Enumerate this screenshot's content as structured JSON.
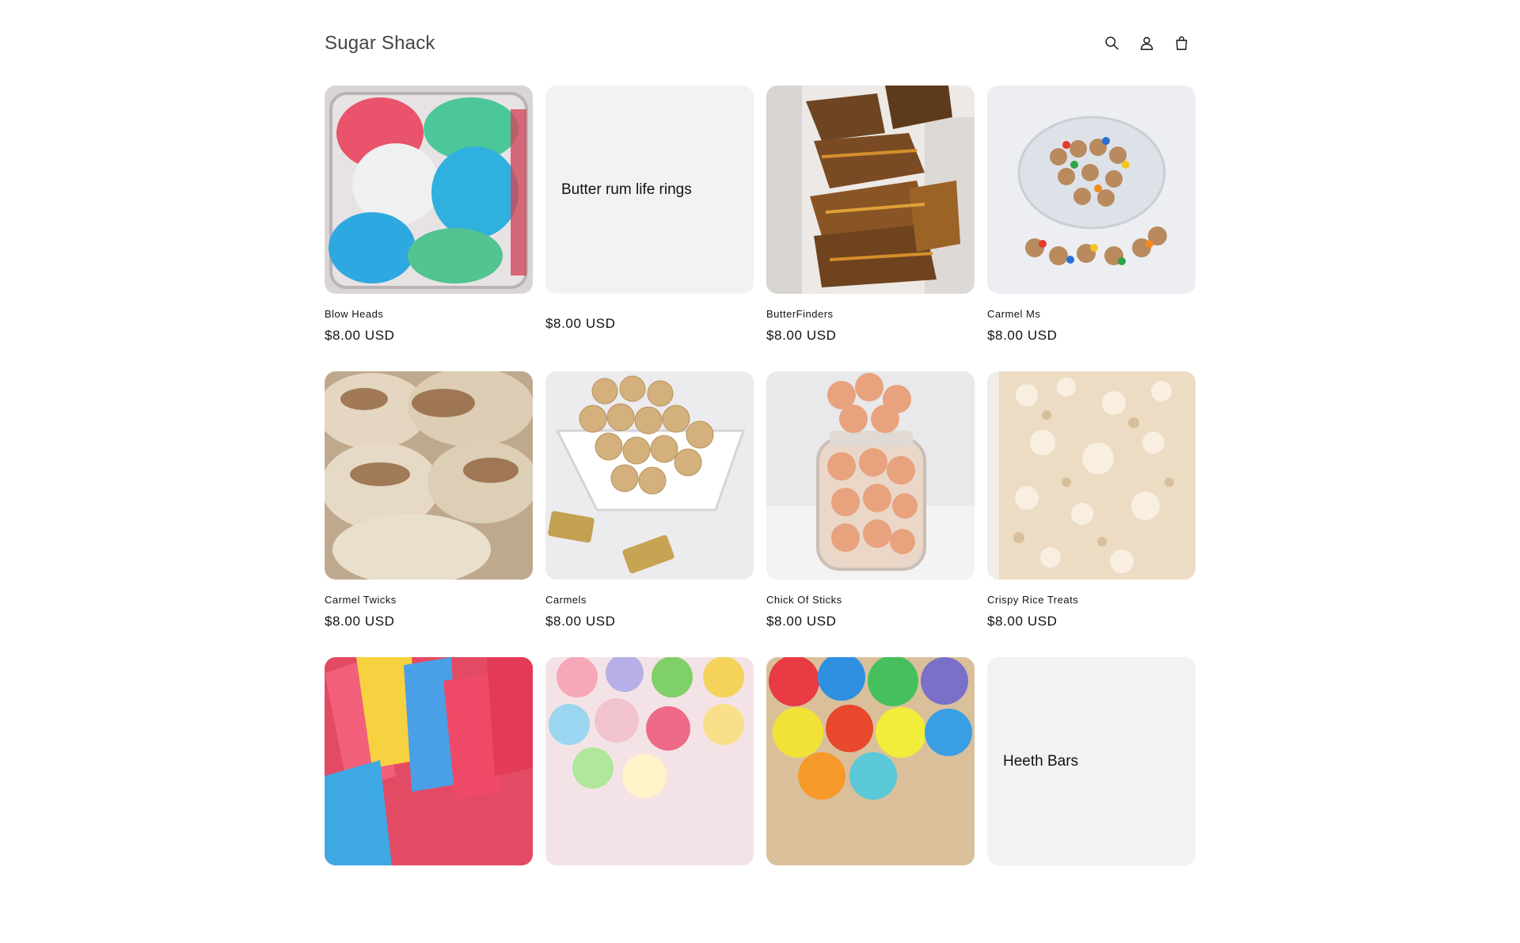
{
  "store": {
    "name": "Sugar Shack"
  },
  "header": {
    "icons": [
      "search-icon",
      "account-icon",
      "cart-icon"
    ]
  },
  "products": [
    {
      "title": "Blow Heads",
      "price": "$8.00 USD",
      "image": "candy-blobs"
    },
    {
      "title": "",
      "placeholder": "Butter rum life rings",
      "price": "$8.00 USD",
      "image": "none"
    },
    {
      "title": "ButterFinders",
      "price": "$8.00 USD",
      "image": "butterfinger-bars"
    },
    {
      "title": "Carmel Ms",
      "price": "$8.00 USD",
      "image": "candy-bowl"
    },
    {
      "title": "Carmel Twicks",
      "price": "$8.00 USD",
      "image": "puffed-twix"
    },
    {
      "title": "Carmels",
      "price": "$8.00 USD",
      "image": "caramel-balls"
    },
    {
      "title": "Chick Of Sticks",
      "price": "$8.00 USD",
      "image": "jar-puffs"
    },
    {
      "title": "Crispy Rice Treats",
      "price": "$8.00 USD",
      "image": "rice-treat"
    },
    {
      "title": "",
      "price": "",
      "image": "sour-straws"
    },
    {
      "title": "",
      "price": "",
      "image": "gummy-bears"
    },
    {
      "title": "",
      "price": "",
      "image": "puffed-candies"
    },
    {
      "title": "",
      "placeholder": "Heeth Bars",
      "price": "",
      "image": "none"
    }
  ]
}
